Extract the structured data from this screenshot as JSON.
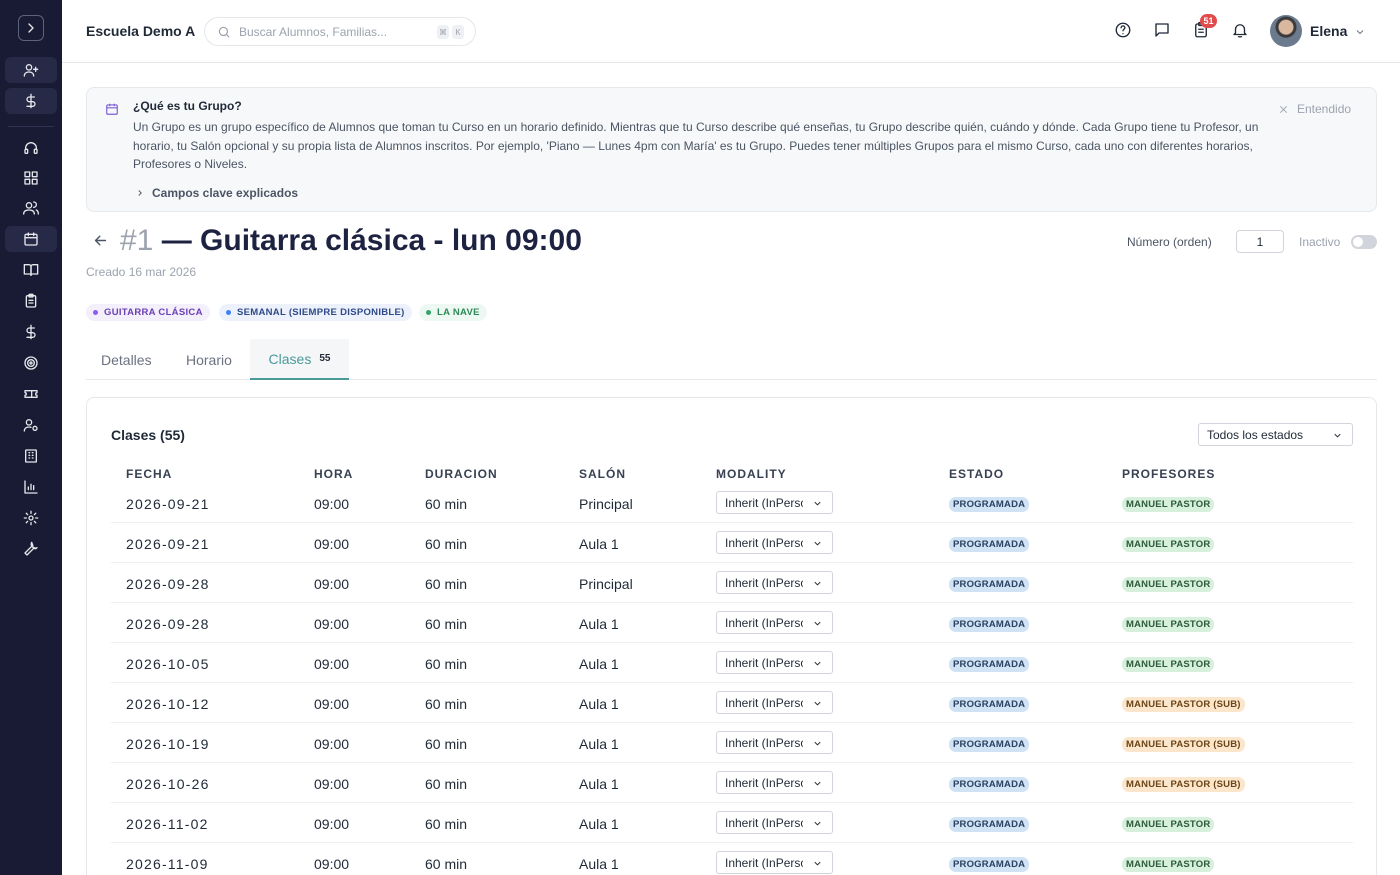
{
  "header": {
    "school": "Escuela Demo A",
    "search_placeholder": "Buscar Alumnos, Familias...",
    "kbd1": "⌘",
    "kbd2": "K",
    "notif_count": "51",
    "user": "Elena"
  },
  "info": {
    "title": "¿Qué es tu Grupo?",
    "body": "Un Grupo es un grupo específico de Alumnos que toman tu Curso en un horario definido. Mientras que tu Curso describe qué enseñas, tu Grupo describe quién, cuándo y dónde. Cada Grupo tiene tu Profesor, un horario, tu Salón opcional y su propia lista de Alumnos inscritos. Por ejemplo, 'Piano — Lunes 4pm con María' es tu Grupo. Puedes tener múltiples Grupos para el mismo Curso, cada uno con diferentes horarios, Profesores o Niveles.",
    "dismiss": "Entendido",
    "more": "Campos clave explicados"
  },
  "group": {
    "number": "#1",
    "name": "— Guitarra clásica - lun 09:00",
    "created": "Creado 16 mar 2026",
    "order_label": "Número (orden)",
    "order_value": "1",
    "inactive_label": "Inactivo"
  },
  "chips": [
    "GUITARRA CLÁSICA",
    "SEMANAL (SIEMPRE DISPONIBLE)",
    "LA NAVE"
  ],
  "tabs": [
    {
      "label": "Detalles"
    },
    {
      "label": "Horario"
    },
    {
      "label": "Clases",
      "count": "55"
    }
  ],
  "classes": {
    "title": "Clases (55)",
    "filter": "Todos los estados",
    "headers": [
      "FECHA",
      "HORA",
      "DURACION",
      "SALÓN",
      "MODALITY",
      "ESTADO",
      "PROFESORES"
    ],
    "rows": [
      {
        "fecha": "2026-09-21",
        "hora": "09:00",
        "dur": "60 min",
        "salon": "Principal",
        "modality": "Inherit (InPerson)",
        "estado": "PROGRAMADA",
        "prof": "MANUEL PASTOR",
        "sub": false
      },
      {
        "fecha": "2026-09-21",
        "hora": "09:00",
        "dur": "60 min",
        "salon": "Aula 1",
        "modality": "Inherit (InPerson)",
        "estado": "PROGRAMADA",
        "prof": "MANUEL PASTOR",
        "sub": false
      },
      {
        "fecha": "2026-09-28",
        "hora": "09:00",
        "dur": "60 min",
        "salon": "Principal",
        "modality": "Inherit (InPerson)",
        "estado": "PROGRAMADA",
        "prof": "MANUEL PASTOR",
        "sub": false
      },
      {
        "fecha": "2026-09-28",
        "hora": "09:00",
        "dur": "60 min",
        "salon": "Aula 1",
        "modality": "Inherit (InPerson)",
        "estado": "PROGRAMADA",
        "prof": "MANUEL PASTOR",
        "sub": false
      },
      {
        "fecha": "2026-10-05",
        "hora": "09:00",
        "dur": "60 min",
        "salon": "Aula 1",
        "modality": "Inherit (InPerson)",
        "estado": "PROGRAMADA",
        "prof": "MANUEL PASTOR",
        "sub": false
      },
      {
        "fecha": "2026-10-12",
        "hora": "09:00",
        "dur": "60 min",
        "salon": "Aula 1",
        "modality": "Inherit (InPerson)",
        "estado": "PROGRAMADA",
        "prof": "MANUEL PASTOR (SUB)",
        "sub": true
      },
      {
        "fecha": "2026-10-19",
        "hora": "09:00",
        "dur": "60 min",
        "salon": "Aula 1",
        "modality": "Inherit (InPerson)",
        "estado": "PROGRAMADA",
        "prof": "MANUEL PASTOR (SUB)",
        "sub": true
      },
      {
        "fecha": "2026-10-26",
        "hora": "09:00",
        "dur": "60 min",
        "salon": "Aula 1",
        "modality": "Inherit (InPerson)",
        "estado": "PROGRAMADA",
        "prof": "MANUEL PASTOR (SUB)",
        "sub": true
      },
      {
        "fecha": "2026-11-02",
        "hora": "09:00",
        "dur": "60 min",
        "salon": "Aula 1",
        "modality": "Inherit (InPerson)",
        "estado": "PROGRAMADA",
        "prof": "MANUEL PASTOR",
        "sub": false
      },
      {
        "fecha": "2026-11-09",
        "hora": "09:00",
        "dur": "60 min",
        "salon": "Aula 1",
        "modality": "Inherit (InPerson)",
        "estado": "PROGRAMADA",
        "prof": "MANUEL PASTOR",
        "sub": false
      }
    ]
  },
  "sidebar": {
    "icons": [
      "user-plus-icon",
      "dollar-icon",
      "headset-icon",
      "grid-icon",
      "users-icon",
      "calendar-icon",
      "book-icon",
      "clipboard-icon",
      "dollar-icon",
      "target-icon",
      "ticket-icon",
      "user-cog-icon",
      "building-icon",
      "chart-icon",
      "settings-icon",
      "wrench-icon"
    ]
  }
}
